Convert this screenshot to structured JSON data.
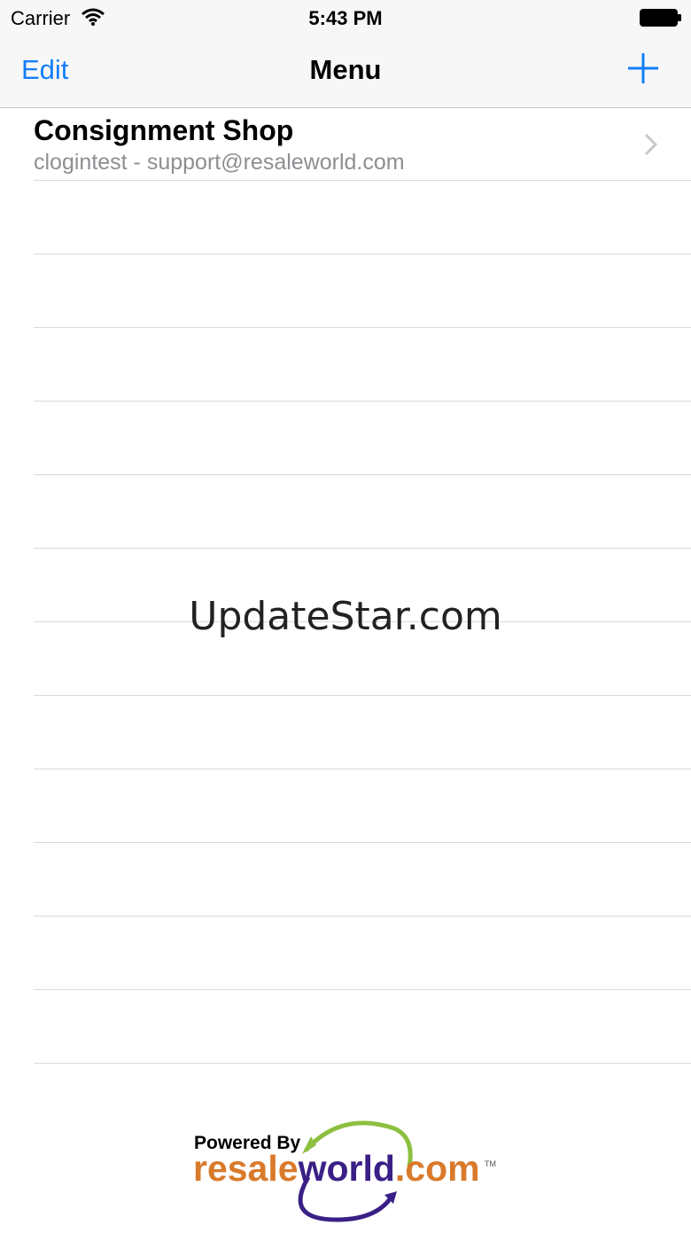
{
  "status_bar": {
    "carrier": "Carrier",
    "time": "5:43 PM",
    "wifi_icon": "wifi-icon",
    "battery_icon": "battery-icon"
  },
  "nav_bar": {
    "left_button": "Edit",
    "title": "Menu",
    "right_button_icon": "plus-icon"
  },
  "rows": [
    {
      "title": "Consignment Shop",
      "subtitle": "clogintest - support@resaleworld.com",
      "accessory_icon": "chevron-right-icon"
    }
  ],
  "watermark": "UpdateStar.com",
  "footer": {
    "powered_by": "Powered By",
    "brand_part1": "resale",
    "brand_part2": "world",
    "brand_part3": ".com",
    "trademark": "TM",
    "colors": {
      "resale": "#d97a2b",
      "world": "#3a1f86",
      "dotcom": "#d97a2b",
      "arc_green": "#8cbf3f",
      "arc_purple": "#3a1f86"
    }
  },
  "colors": {
    "accent": "#147efb",
    "secondary_text": "#8e8e93",
    "separator": "#dadada"
  }
}
